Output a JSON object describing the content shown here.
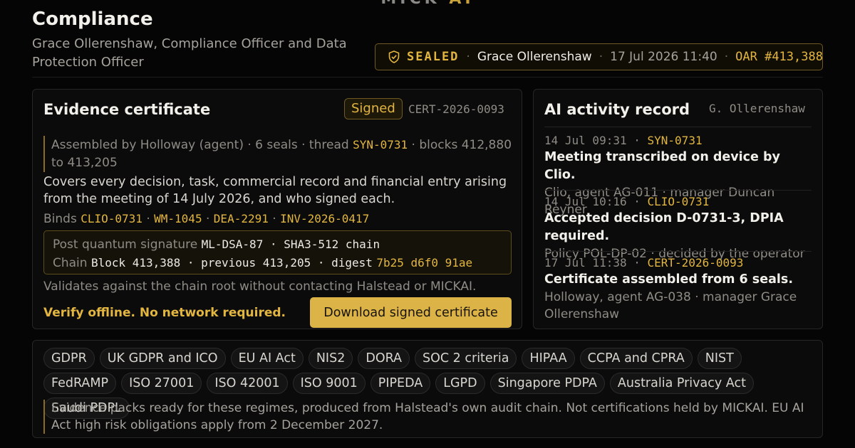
{
  "brand": {
    "name": "MICK",
    "accent": "AI"
  },
  "header": {
    "title": "Compliance",
    "subtitle": "Grace Ollerenshaw, Compliance Officer and Data Protection Officer"
  },
  "seal": {
    "icon": "shield-check-icon",
    "status": "SEALED",
    "signer": "Grace Ollerenshaw",
    "timestamp": "17 Jul 2026 11:40",
    "oar": "OAR #413,388"
  },
  "certificate": {
    "title": "Evidence certificate",
    "badge": "Signed",
    "id": "CERT-2026-0093",
    "assembled_prefix": "Assembled by Holloway (agent) · 6 seals · thread",
    "thread": "SYN-0731",
    "assembled_suffix": "· blocks 412,880 to 413,205",
    "covers": "Covers every decision, task, commercial record and financial entry arising from the meeting of 14 July 2026, and who signed each.",
    "binds_label": "Binds",
    "binds": [
      "CLIO-0731",
      "WM-1045",
      "DEA-2291",
      "INV-2026-0417"
    ],
    "binds_sep": "·",
    "signature_label": "Post quantum signature",
    "signature_value": "ML-DSA-87 · SHA3-512 chain",
    "chain_label": "Chain",
    "chain_value": "Block 413,388 · previous 413,205 · digest",
    "digest": "7b25 d6f0 91ae",
    "validates": "Validates against the chain root without contacting Halstead or MICKAI.",
    "verify": "Verify offline. No network required.",
    "download_label": "Download signed certificate"
  },
  "ai_record": {
    "title": "AI activity record",
    "owner": "G. Ollerenshaw",
    "entries": [
      {
        "time": "14 Jul 09:31",
        "sep": "·",
        "ref": "SYN-0731",
        "headline": "Meeting transcribed on device by Clio.",
        "detail": "Clio, agent AG-011 · manager Duncan Reyner"
      },
      {
        "time": "14 Jul 10:16",
        "sep": "·",
        "ref": "CLIO-0731",
        "headline": "Accepted decision D-0731-3, DPIA required.",
        "detail": "Policy POL-DP-02 · decided by the operator"
      },
      {
        "time": "17 Jul 11:38",
        "sep": "·",
        "ref": "CERT-2026-0093",
        "headline": "Certificate assembled from 6 seals.",
        "detail": "Holloway, agent AG-038 · manager Grace Ollerenshaw"
      }
    ]
  },
  "regimes": {
    "chips": [
      "GDPR",
      "UK GDPR and ICO",
      "EU AI Act",
      "NIS2",
      "DORA",
      "SOC 2 criteria",
      "HIPAA",
      "CCPA and CPRA",
      "NIST",
      "FedRAMP",
      "ISO 27001",
      "ISO 42001",
      "ISO 9001",
      "PIPEDA",
      "LGPD",
      "Singapore PDPA",
      "Australia Privacy Act",
      "Saudi PDPL"
    ],
    "note": "Evidence packs ready for these regimes, produced from Halstead's own audit chain. Not certifications held by MICKAI. EU AI Act high risk obligations apply from 2 December 2027."
  },
  "colors": {
    "accent": "#e3b63f",
    "background": "#050505",
    "card": "#0b0b0b",
    "button": "#dcb347"
  }
}
